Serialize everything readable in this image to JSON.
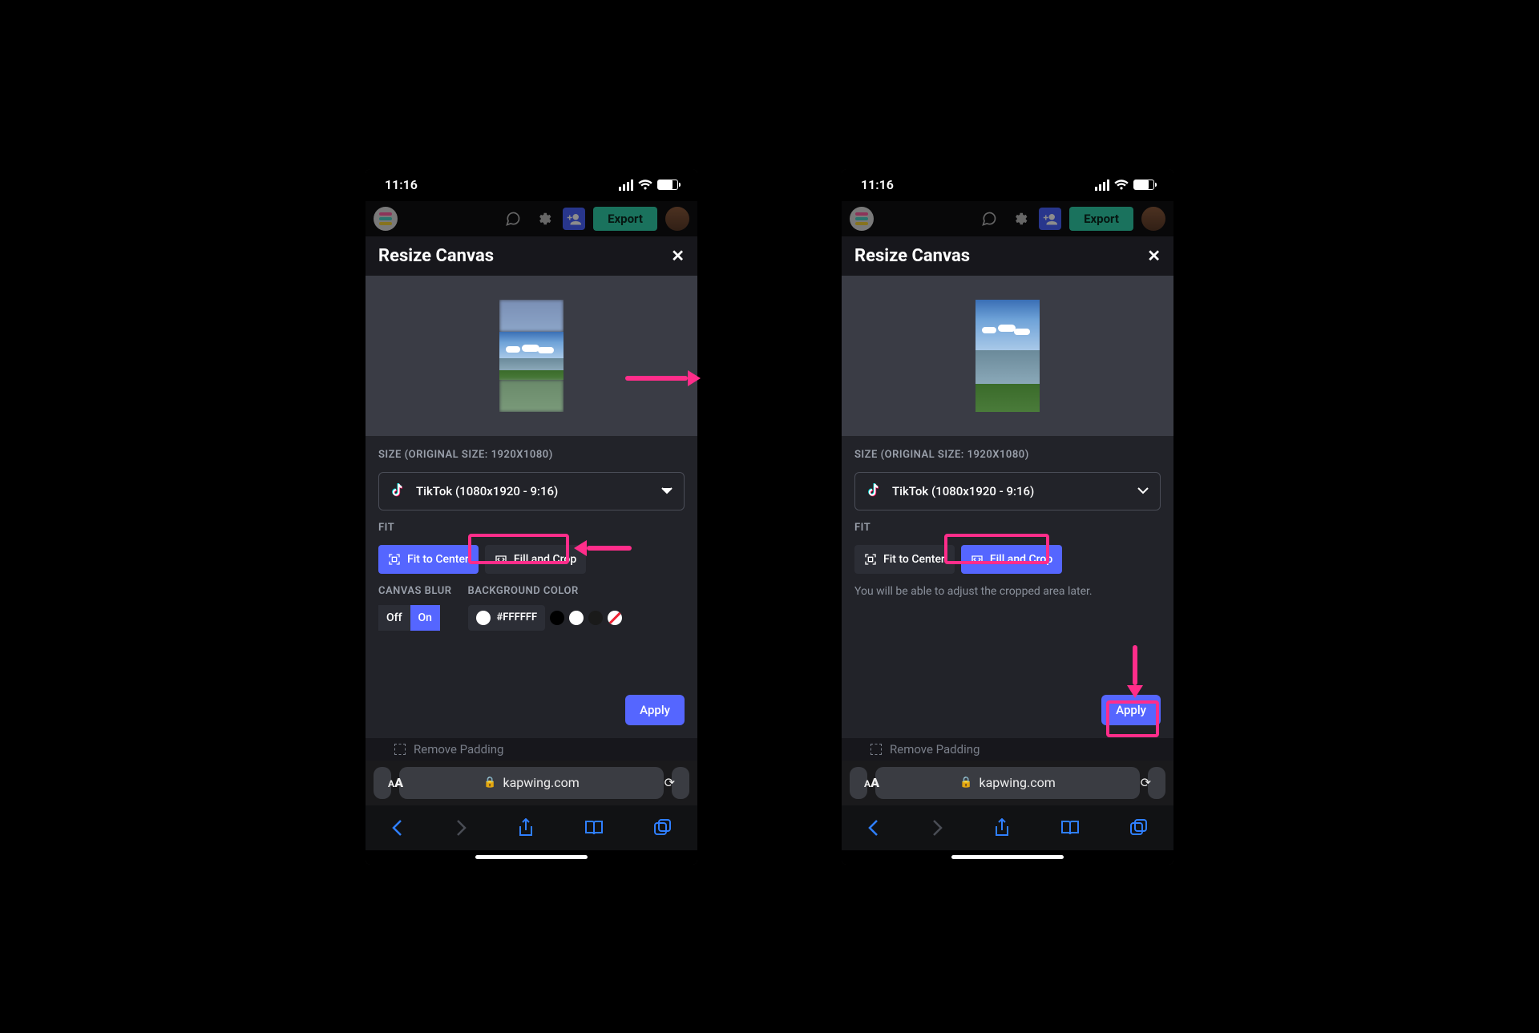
{
  "statusbar": {
    "time": "11:16"
  },
  "toolbar": {
    "export_label": "Export"
  },
  "modal": {
    "title": "Resize Canvas",
    "size_label": "SIZE (ORIGINAL SIZE: 1920X1080)",
    "size_value": "TikTok (1080x1920 - 9:16)",
    "fit_label": "FIT",
    "fit_center": "Fit to Center",
    "fill_crop": "Fill and Crop",
    "canvas_blur_label": "CANVAS BLUR",
    "blur_off": "Off",
    "blur_on": "On",
    "bgcolor_label": "BACKGROUND COLOR",
    "bgcolor_value": "#FFFFFF",
    "crop_note": "You will be able to adjust the cropped area later.",
    "apply_label": "Apply"
  },
  "below": {
    "remove_padding": "Remove Padding"
  },
  "browser": {
    "domain": "kapwing.com"
  }
}
